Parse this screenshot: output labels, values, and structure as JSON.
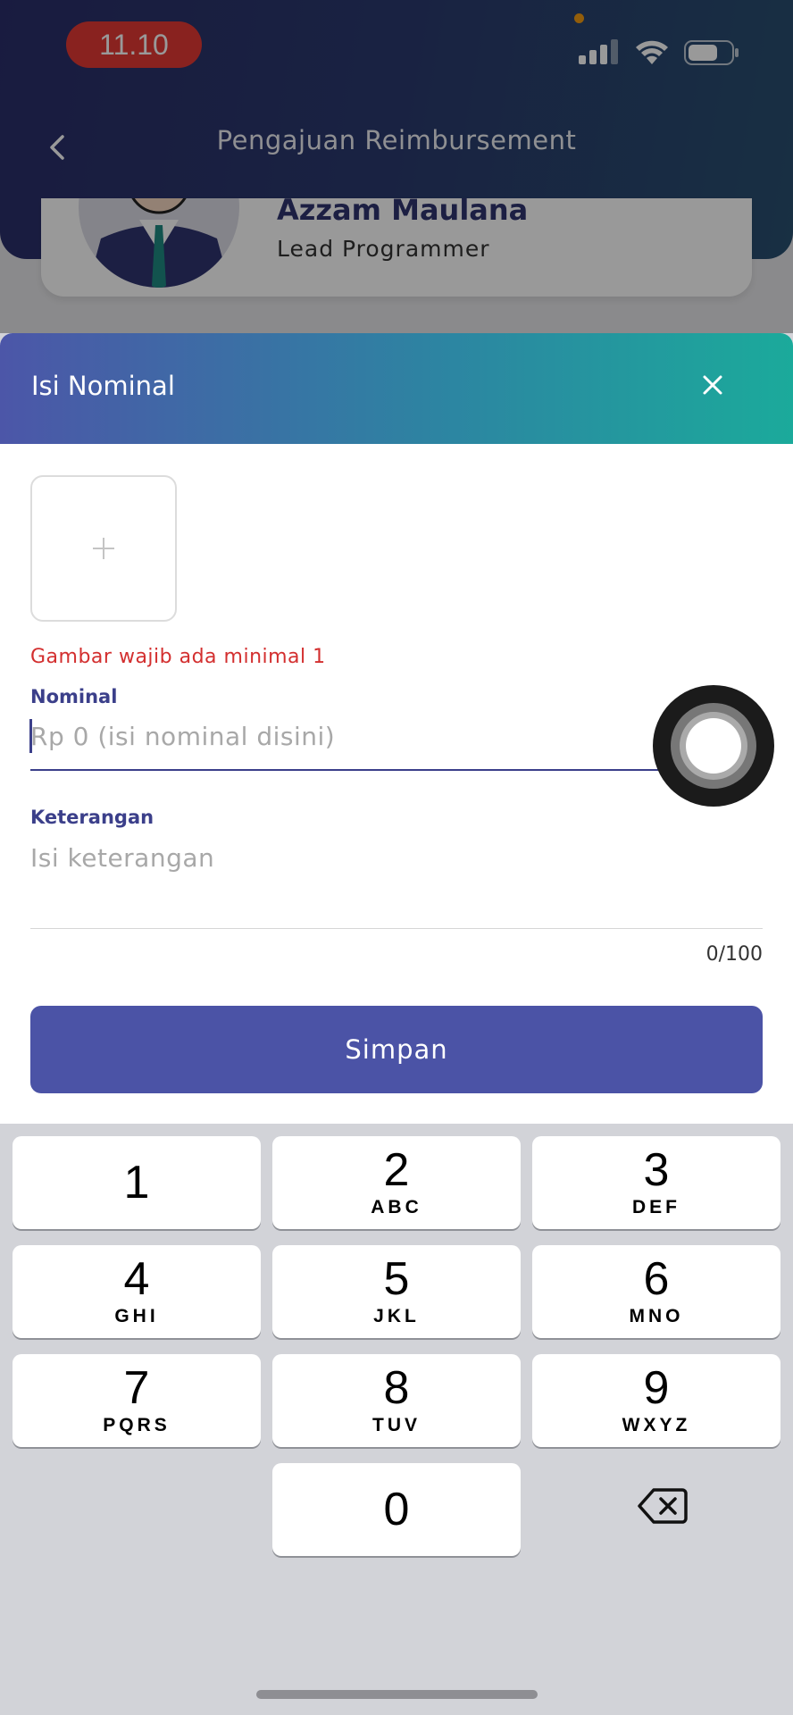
{
  "status_bar": {
    "time": "11.10"
  },
  "header": {
    "title": "Pengajuan Reimbursement",
    "back_icon": "chevron-left-icon"
  },
  "profile": {
    "name": "Azzam Maulana",
    "role": "Lead Programmer"
  },
  "modal": {
    "title": "Isi Nominal",
    "close_icon": "close-icon",
    "add_image_icon": "plus-icon",
    "image_error": "Gambar wajib ada minimal 1",
    "nominal": {
      "label": "Nominal",
      "placeholder": "Rp 0 (isi nominal disini)",
      "value": ""
    },
    "keterangan": {
      "label": "Keterangan",
      "placeholder": "Isi keterangan",
      "value": "",
      "counter": "0/100"
    },
    "save_label": "Simpan"
  },
  "keypad": {
    "keys": [
      {
        "num": "1",
        "letters": ""
      },
      {
        "num": "2",
        "letters": "ABC"
      },
      {
        "num": "3",
        "letters": "DEF"
      },
      {
        "num": "4",
        "letters": "GHI"
      },
      {
        "num": "5",
        "letters": "JKL"
      },
      {
        "num": "6",
        "letters": "MNO"
      },
      {
        "num": "7",
        "letters": "PQRS"
      },
      {
        "num": "8",
        "letters": "TUV"
      },
      {
        "num": "9",
        "letters": "WXYZ"
      },
      {
        "num": "0",
        "letters": ""
      }
    ],
    "backspace_icon": "backspace-icon"
  },
  "colors": {
    "primary": "#4b53a6",
    "gradient_start": "#4c56a8",
    "gradient_end": "#1baa9b",
    "error": "#d32f2f",
    "status_time_bg": "#e53935"
  }
}
